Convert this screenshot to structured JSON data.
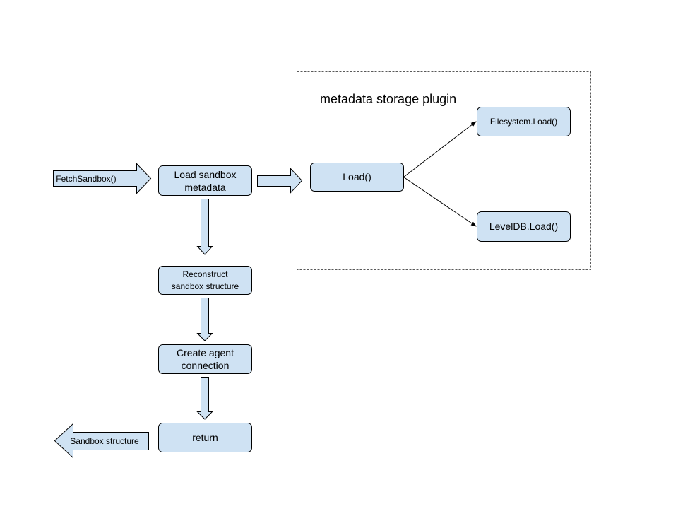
{
  "diagram": {
    "group": {
      "title": "metadata storage plugin"
    },
    "input_arrow": {
      "label": "FetchSandbox()"
    },
    "output_arrow": {
      "label": "Sandbox structure"
    },
    "nodes": {
      "load_sandbox_metadata": {
        "lines": [
          "Load sandbox",
          "metadata"
        ]
      },
      "reconstruct": {
        "lines": [
          "Reconstruct",
          "sandbox structure"
        ]
      },
      "create_agent": {
        "lines": [
          "Create agent",
          "connection"
        ]
      },
      "return": {
        "lines": [
          "return"
        ]
      },
      "load": {
        "lines": [
          "Load()"
        ]
      },
      "filesystem_load": {
        "lines": [
          "Filesystem.Load()"
        ]
      },
      "leveldb_load": {
        "lines": [
          "LevelDB.Load()"
        ]
      }
    },
    "edges": [
      {
        "from": "FetchSandbox()",
        "to": "load_sandbox_metadata",
        "style": "block-arrow"
      },
      {
        "from": "load_sandbox_metadata",
        "to": "load",
        "style": "block-arrow"
      },
      {
        "from": "load_sandbox_metadata",
        "to": "reconstruct",
        "style": "block-arrow"
      },
      {
        "from": "reconstruct",
        "to": "create_agent",
        "style": "block-arrow"
      },
      {
        "from": "create_agent",
        "to": "return",
        "style": "block-arrow"
      },
      {
        "from": "return",
        "to": "Sandbox structure",
        "style": "block-arrow"
      },
      {
        "from": "load",
        "to": "filesystem_load",
        "style": "line-arrow"
      },
      {
        "from": "load",
        "to": "leveldb_load",
        "style": "line-arrow"
      }
    ],
    "colors": {
      "node_fill": "#cfe2f3",
      "node_stroke": "#000000",
      "group_border": "#595959"
    }
  }
}
